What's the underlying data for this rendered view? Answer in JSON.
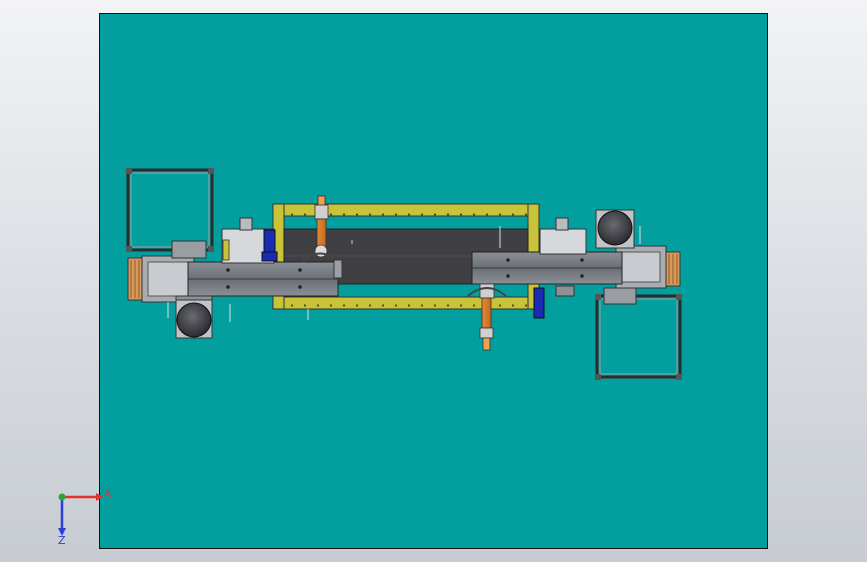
{
  "app": {
    "type": "CAD 3D model viewport",
    "colors": {
      "background_gradient_top": "#f2f3f5",
      "background_gradient_bottom": "#c7ccd2",
      "sheet_teal": "#039f9f",
      "frame_yellow": "#c9c33a",
      "conveyor_dark": "#3f3f44",
      "beam_gray": "#6f7378",
      "robot_orange": "#c8621c",
      "motor_blue": "#1a2bb5",
      "wheel_dark": "#3d3d44"
    }
  },
  "triad": {
    "x_label": "X",
    "z_label": "Z",
    "icon": "coordinate-triad-icon",
    "x_color": "#e43030",
    "y_color": "#2aa534",
    "z_color": "#2a3ed8"
  }
}
